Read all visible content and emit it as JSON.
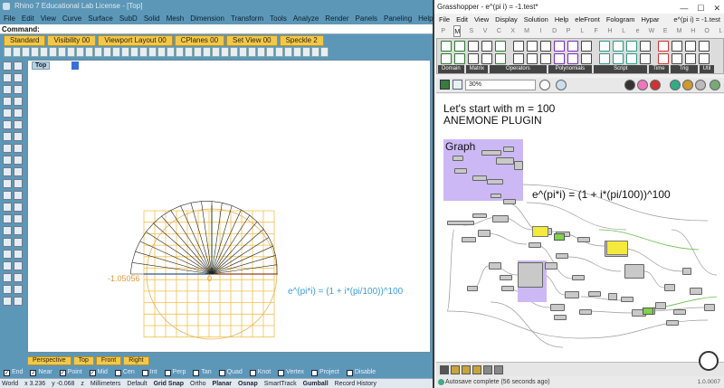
{
  "rhino": {
    "title": "Rhino 7 Educational Lab License - [Top]",
    "menu": [
      "File",
      "Edit",
      "View",
      "Curve",
      "Surface",
      "SubD",
      "Solid",
      "Mesh",
      "Dimension",
      "Transform",
      "Tools",
      "Analyze",
      "Render",
      "Panels",
      "Paneling Tools",
      "Help"
    ],
    "command_prompt": "Command:",
    "toolbar_tabs": [
      "Standard",
      "Visibility 00",
      "Viewport Layout 00",
      "CPlanes 00",
      "Set View 00",
      "Speckle 2"
    ],
    "viewport_title": "Top",
    "coord_label": "-1.05056",
    "zero_label": "0",
    "formula_label": "e^(pi*i) = (1 + i*(pi/100))^100",
    "view_tabs": [
      "Perspective",
      "Top",
      "Front",
      "Right"
    ],
    "snaps": [
      {
        "label": "End",
        "checked": true
      },
      {
        "label": "Near",
        "checked": true
      },
      {
        "label": "Point",
        "checked": true
      },
      {
        "label": "Mid",
        "checked": true
      },
      {
        "label": "Cen",
        "checked": false
      },
      {
        "label": "Int",
        "checked": false
      },
      {
        "label": "Perp",
        "checked": false
      },
      {
        "label": "Tan",
        "checked": false
      },
      {
        "label": "Quad",
        "checked": false
      },
      {
        "label": "Knot",
        "checked": false
      },
      {
        "label": "Vertex",
        "checked": false
      },
      {
        "label": "Project",
        "checked": false
      },
      {
        "label": "Disable",
        "checked": false
      }
    ],
    "status": {
      "cplane": "World",
      "x": "x 3.236",
      "y": "y -0.068",
      "z": "z",
      "units": "Millimeters",
      "layer": "Default",
      "grid_snap": "Grid Snap",
      "ortho": "Ortho",
      "planar": "Planar",
      "osnap": "Osnap",
      "smarttrack": "SmartTrack",
      "gumball": "Gumball",
      "record_history": "Record History"
    }
  },
  "gh": {
    "title": "Grasshopper - e^(pi i) = -1.test*",
    "window_buttons": [
      "—",
      "☐",
      "✕"
    ],
    "menu": [
      "File",
      "Edit",
      "View",
      "Display",
      "Solution",
      "Help",
      "eleFront",
      "Fologram",
      "Hypar"
    ],
    "doc_name": "e^(pi i) = -1.test",
    "categories": [
      "P",
      "M",
      "S",
      "V",
      "C",
      "X",
      "M",
      "I",
      "D",
      "P",
      "L",
      "F",
      "H",
      "L",
      "e",
      "W",
      "E",
      "M",
      "H",
      "O",
      "L"
    ],
    "active_category_index": 1,
    "ribbon_groups": [
      "Domain",
      "Matrix",
      "Operators",
      "Polynomials",
      "Script",
      "Time",
      "Trig",
      "Util"
    ],
    "zoom": "30%",
    "canvas_title_1": "Let's start with m = 100",
    "canvas_title_2": "ANEMONE PLUGIN",
    "graph_label": "Graph",
    "canvas_formula": "e^(pi*i) = (1 + i*(pi/100))^100",
    "status_text": "Autosave complete (56 seconds ago)",
    "version": "1.0.0007"
  }
}
